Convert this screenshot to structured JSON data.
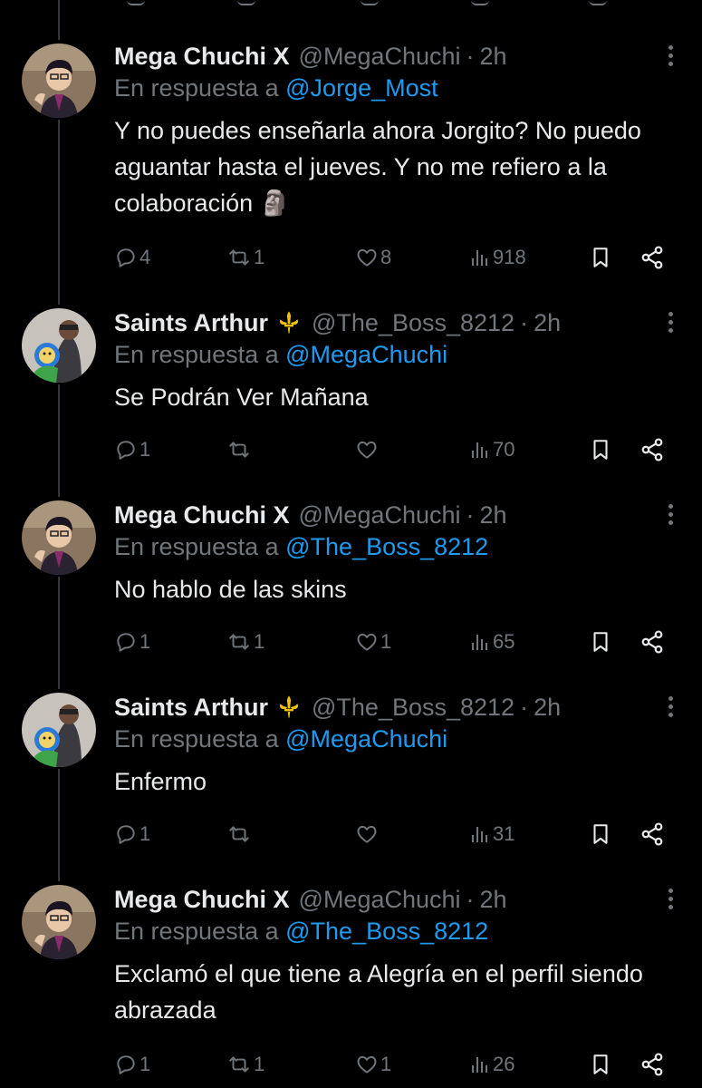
{
  "tweets": [
    {
      "name": "Mega Chuchi X",
      "handle": "@MegaChuchi",
      "dot": "·",
      "time": "2h",
      "reply_prefix": "En respuesta a",
      "reply_to": "@Jorge_Most",
      "text": "Y no puedes enseñarla ahora Jorgito? No puedo aguantar hasta el jueves. Y no me refiero a la colaboración 🗿",
      "replies": "4",
      "retweets": "1",
      "likes": "8",
      "views": "918"
    },
    {
      "name": "Saints Arthur",
      "badge": "⚜",
      "handle": "@The_Boss_8212",
      "dot": "·",
      "time": "2h",
      "reply_prefix": "En respuesta a",
      "reply_to": "@MegaChuchi",
      "text": "Se Podrán Ver Mañana",
      "replies": "1",
      "retweets": "",
      "likes": "",
      "views": "70"
    },
    {
      "name": "Mega Chuchi X",
      "handle": "@MegaChuchi",
      "dot": "·",
      "time": "2h",
      "reply_prefix": "En respuesta a",
      "reply_to": "@The_Boss_8212",
      "text": "No hablo de las skins",
      "replies": "1",
      "retweets": "1",
      "likes": "1",
      "views": "65"
    },
    {
      "name": "Saints Arthur",
      "badge": "⚜",
      "handle": "@The_Boss_8212",
      "dot": "·",
      "time": "2h",
      "reply_prefix": "En respuesta a",
      "reply_to": "@MegaChuchi",
      "text": "Enfermo",
      "replies": "1",
      "retweets": "",
      "likes": "",
      "views": "31"
    },
    {
      "name": "Mega Chuchi X",
      "handle": "@MegaChuchi",
      "dot": "·",
      "time": "2h",
      "reply_prefix": "En respuesta a",
      "reply_to": "@The_Boss_8212",
      "text": "Exclamó el que tiene a Alegría en el perfil siendo abrazada",
      "replies": "1",
      "retweets": "1",
      "likes": "1",
      "views": "26"
    }
  ],
  "icons": {
    "reply": "reply-icon",
    "retweet": "retweet-icon",
    "like": "heart-icon",
    "views": "views-icon",
    "bookmark": "bookmark-icon",
    "share": "share-icon",
    "more": "more-icon"
  },
  "colors": {
    "background": "#000000",
    "text": "#e7e9ea",
    "muted": "#71767b",
    "link": "#1d9bf0",
    "divider": "#333639",
    "badge": "#f4c300"
  }
}
